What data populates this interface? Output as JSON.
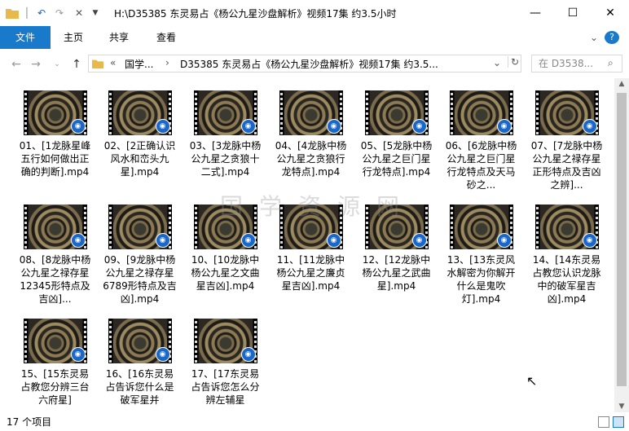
{
  "titlebar": {
    "path": "H:\\D35385 东灵易占《杨公九星沙盘解析》视频17集 约3.5小时",
    "minimize": "—",
    "maximize": "☐",
    "close": "✕"
  },
  "ribbon": {
    "tabs": [
      "文件",
      "主页",
      "共享",
      "查看"
    ],
    "expand_icon": "⌄",
    "help_icon": "?"
  },
  "address": {
    "prefix": "«",
    "crumb1": "国学...",
    "sep": "›",
    "crumb2": "D35385 东灵易占《杨公九星沙盘解析》视频17集 约3.5...",
    "dropdown": "⌄",
    "refresh": "↻",
    "search_placeholder": "在 D3538..."
  },
  "files": [
    {
      "label": "01、[1龙脉星峰五行如何做出正确的判断].mp4"
    },
    {
      "label": "02、[2正确认识风水和峦头九星].mp4"
    },
    {
      "label": "03、[3龙脉中杨公九星之贪狼十二式].mp4"
    },
    {
      "label": "04、[4龙脉中杨公九星之贪狼行龙特点].mp4"
    },
    {
      "label": "05、[5龙脉中杨公九星之巨门星行龙特点].mp4"
    },
    {
      "label": "06、[6龙脉中杨公九星之巨门星行龙特点及天马砂之..."
    },
    {
      "label": "07、[7龙脉中杨公九星之禄存星正形特点及吉凶之辨]..."
    },
    {
      "label": "08、[8龙脉中杨公九星之禄存星12345形特点及吉凶]..."
    },
    {
      "label": "09、[9龙脉中杨公九星之禄存星6789形特点及吉凶].mp4"
    },
    {
      "label": "10、[10龙脉中杨公九星之文曲星吉凶].mp4"
    },
    {
      "label": "11、[11龙脉中杨公九星之廉贞星吉凶].mp4"
    },
    {
      "label": "12、[12龙脉中杨公九星之武曲星].mp4"
    },
    {
      "label": "13、[13东灵风水解密为你解开什么是鬼吹灯].mp4"
    },
    {
      "label": "14、[14东灵易占教您认识龙脉中的破军星吉凶].mp4"
    },
    {
      "label": "15、[15东灵易占教您分辨三台六府星]"
    },
    {
      "label": "16、[16东灵易占告诉您什么是破军星并"
    },
    {
      "label": "17、[17东灵易占告诉您怎么分辨左辅星"
    }
  ],
  "watermark": "国学资源网",
  "status": {
    "count": "17 个项目"
  }
}
